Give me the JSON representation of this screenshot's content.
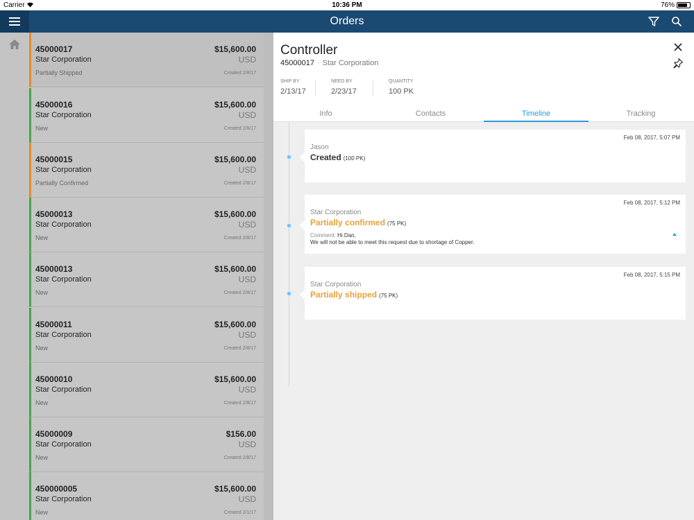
{
  "status_bar": {
    "carrier": "Carrier",
    "time": "10:36 PM",
    "battery": "76%"
  },
  "nav": {
    "title": "Orders"
  },
  "icons": [
    "menu-icon",
    "filter-icon",
    "search-icon",
    "home-icon",
    "close-icon",
    "pin-icon",
    "caret-up-icon"
  ],
  "colors": {
    "navbar": "#1a4a72",
    "accent": "#2a9cd8",
    "status_orange": "#e58a2e",
    "status_green": "#4aa44a",
    "event_orange": "#e8a13a"
  },
  "orders": [
    {
      "number": "45000017",
      "customer": "Star Corporation",
      "status": "Partially Shipped",
      "amount": "$15,600.00",
      "currency": "USD",
      "created": "Created 2/8/17"
    },
    {
      "number": "45000016",
      "customer": "Star Corporation",
      "status": "New",
      "amount": "$15,600.00",
      "currency": "USD",
      "created": "Created 2/8/17"
    },
    {
      "number": "45000015",
      "customer": "Star Corporation",
      "status": "Partially Confirmed",
      "amount": "$15,600.00",
      "currency": "USD",
      "created": "Created 2/8/17"
    },
    {
      "number": "45000013",
      "customer": "Star Corporation",
      "status": "New",
      "amount": "$15,600.00",
      "currency": "USD",
      "created": "Created 2/8/17"
    },
    {
      "number": "45000013",
      "customer": "Star Corporation",
      "status": "New",
      "amount": "$15,600.00",
      "currency": "USD",
      "created": "Created 2/8/17"
    },
    {
      "number": "45000011",
      "customer": "Star Corporation",
      "status": "New",
      "amount": "$15,600.00",
      "currency": "USD",
      "created": "Created 2/8/17"
    },
    {
      "number": "45000010",
      "customer": "Star Corporation",
      "status": "New",
      "amount": "$15,600.00",
      "currency": "USD",
      "created": "Created 2/8/17"
    },
    {
      "number": "45000009",
      "customer": "Star Corporation",
      "status": "New",
      "amount": "$156.00",
      "currency": "USD",
      "created": "Created 2/8/17"
    },
    {
      "number": "450000005",
      "customer": "Star Corporation",
      "status": "New",
      "amount": "$15,600.00",
      "currency": "USD",
      "created": "Created 2/1/17"
    }
  ],
  "detail": {
    "title": "Controller",
    "order_number": "45000017",
    "separator": "·",
    "customer": "Star Corporation",
    "ship_by_label": "SHIP BY",
    "ship_by": "2/13/17",
    "need_by_label": "NEED BY",
    "need_by": "2/23/17",
    "quantity_label": "QUANTITY",
    "quantity": "100 PK",
    "tabs": [
      "Info",
      "Contacts",
      "Timeline",
      "Tracking"
    ],
    "active_tab": "Timeline",
    "timeline": [
      {
        "date": "Feb 08, 2017, 5:07 PM",
        "who": "Jason",
        "event": "Created",
        "qty": "(100 PK)"
      },
      {
        "date": "Feb 08, 2017, 5:12 PM",
        "who": "Star Corporation",
        "event": "Partially confirmed",
        "qty": "(75 PK)",
        "comment_label": "Comment:",
        "comment_line1": "Hi Dan,",
        "comment_line2": "We will not be able to meet this request due to shortage of Copper."
      },
      {
        "date": "Feb 08, 2017, 5:15 PM",
        "who": "Star Corporation",
        "event": "Partially shipped",
        "qty": "(75 PK)"
      }
    ]
  }
}
